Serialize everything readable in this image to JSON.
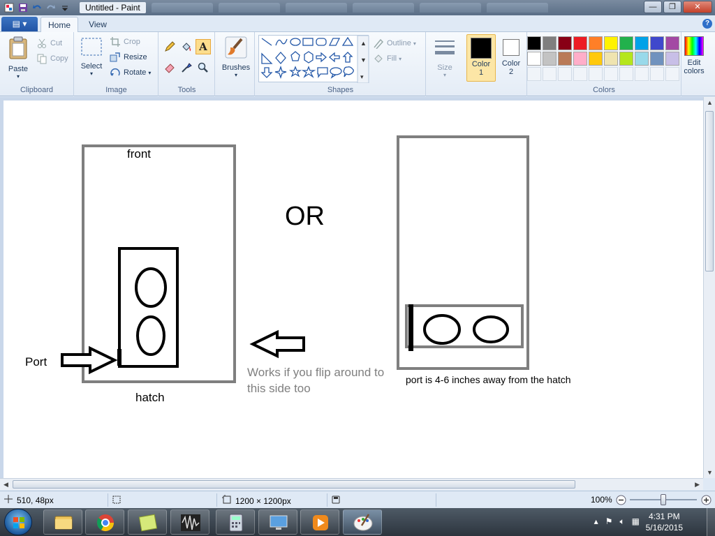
{
  "titlebar": {
    "title": "Untitled - Paint",
    "controls": {
      "minimize": "—",
      "maximize": "❐",
      "close": "✕"
    }
  },
  "tabs": {
    "file": "▤ ▾",
    "home": "Home",
    "view": "View",
    "help": "?"
  },
  "ribbon": {
    "clipboard": {
      "label": "Clipboard",
      "paste": "Paste",
      "cut": "Cut",
      "copy": "Copy"
    },
    "image": {
      "label": "Image",
      "select": "Select",
      "crop": "Crop",
      "resize": "Resize",
      "rotate": "Rotate"
    },
    "tools": {
      "label": "Tools"
    },
    "brushes": {
      "label": "Brushes"
    },
    "shapes": {
      "label": "Shapes",
      "outline": "Outline",
      "fill": "Fill"
    },
    "size": {
      "label": "Size"
    },
    "color1": {
      "label": "Color",
      "num": "1",
      "value": "#000000"
    },
    "color2": {
      "label": "Color",
      "num": "2",
      "value": "#ffffff"
    },
    "colors": {
      "label": "Colors",
      "edit": "Edit colors"
    },
    "palette_row1": [
      "#000000",
      "#7f7f7f",
      "#880015",
      "#ed1c24",
      "#ff7f27",
      "#fff200",
      "#22b14c",
      "#00a2e8",
      "#3f48cc",
      "#a349a4"
    ],
    "palette_row2": [
      "#ffffff",
      "#c3c3c3",
      "#b97a57",
      "#ffaec9",
      "#ffc90e",
      "#efe4b0",
      "#b5e61d",
      "#99d9ea",
      "#7092be",
      "#c8bfe7"
    ]
  },
  "canvas": {
    "texts": {
      "front": "front",
      "or": "OR",
      "port": "Port",
      "hatch": "hatch",
      "flip_line1": "Works if you flip around to",
      "flip_line2": "this side too",
      "distance_note": "port is 4-6 inches away from the hatch"
    }
  },
  "statusbar": {
    "cursor_pos": "510, 48px",
    "image_size": "1200 × 1200px",
    "zoom": "100%",
    "zoom_level": 1.0
  },
  "taskbar": {
    "clock_time": "4:31 PM",
    "clock_date": "5/16/2015"
  }
}
